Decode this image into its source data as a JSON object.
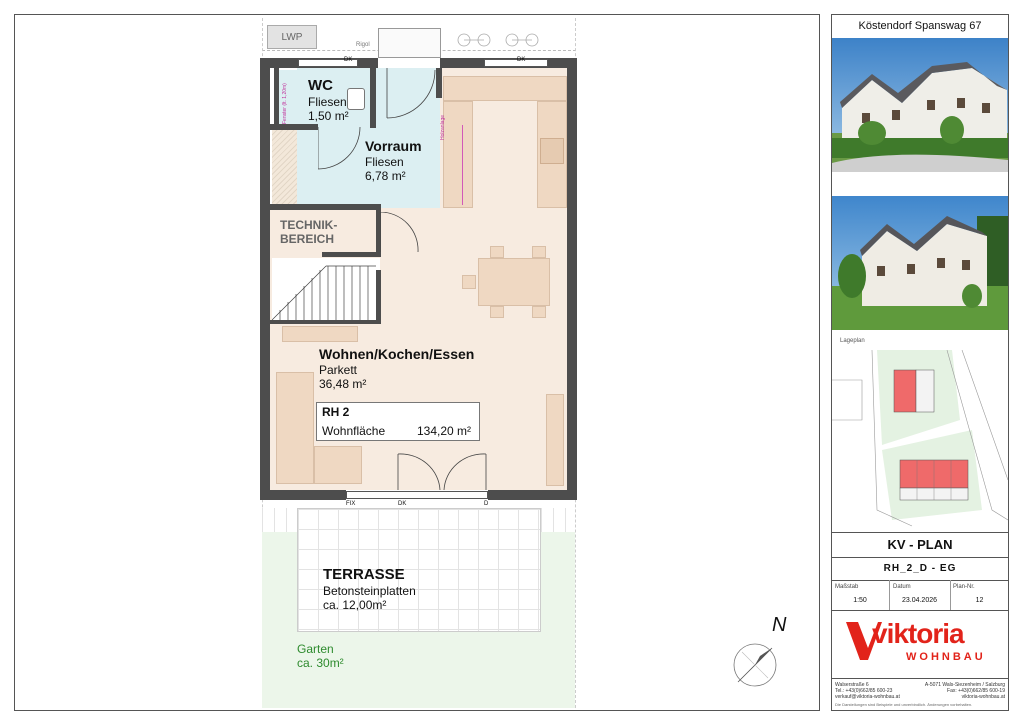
{
  "plan": {
    "lwp_label": "LWP",
    "rigol_label": "Rigol",
    "dk_top_left": "DK",
    "dk_top_right": "DK",
    "fix_label": "FIX",
    "dk_bottom": "DK",
    "d_label": "D",
    "north_label": "N",
    "hwa_label": "Holzanlage",
    "wc": {
      "name": "WC",
      "floor": "Fliesen",
      "area": "1,50 m²",
      "note": "Fenster (lt. 1,20m)"
    },
    "vorraum": {
      "name": "Vorraum",
      "floor": "Fliesen",
      "area": "6,78 m²"
    },
    "technik": {
      "line1": "TECHNIK-",
      "line2": "BEREICH"
    },
    "wohnen": {
      "name": "Wohnen/Kochen/Essen",
      "floor": "Parkett",
      "area": "36,48 m²"
    },
    "rh_box": {
      "title": "RH 2",
      "label": "Wohnfläche",
      "value": "134,20 m²"
    },
    "terrasse": {
      "name": "TERRASSE",
      "floor": "Betonsteinplatten",
      "area": "ca. 12,00m²"
    },
    "garten": {
      "name": "Garten",
      "area": "ca. 30m²"
    }
  },
  "title_block": {
    "project_title": "Köstendorf Spanswag 67",
    "lageplan_label": "Lageplan",
    "plan_type": "KV - PLAN",
    "plan_code": "RH_2_D - EG",
    "massstab_label": "Maßstab",
    "massstab_value": "1:50",
    "datum_label": "Datum",
    "datum_value": "23.04.2026",
    "plannr_label": "Plan-Nr.",
    "plannr_value": "12",
    "logo_text": "viktoria",
    "logo_sub": "WOHNBAU",
    "addr_left_1": "Walserstraße 6",
    "addr_left_2": "Tel.: +43(0)662/85 600-23",
    "addr_left_3": "verkauf@viktoria-wohnbau.at",
    "addr_right_1": "A-5071 Wals-Siezenheim / Salzburg",
    "addr_right_2": "Fax: +43(0)662/85 600-19",
    "addr_right_3": "viktoria-wohnbau.at",
    "footnote": "Die Darstellungen sind Beispiele und unverbindlich. Änderungen vorbehalten."
  }
}
